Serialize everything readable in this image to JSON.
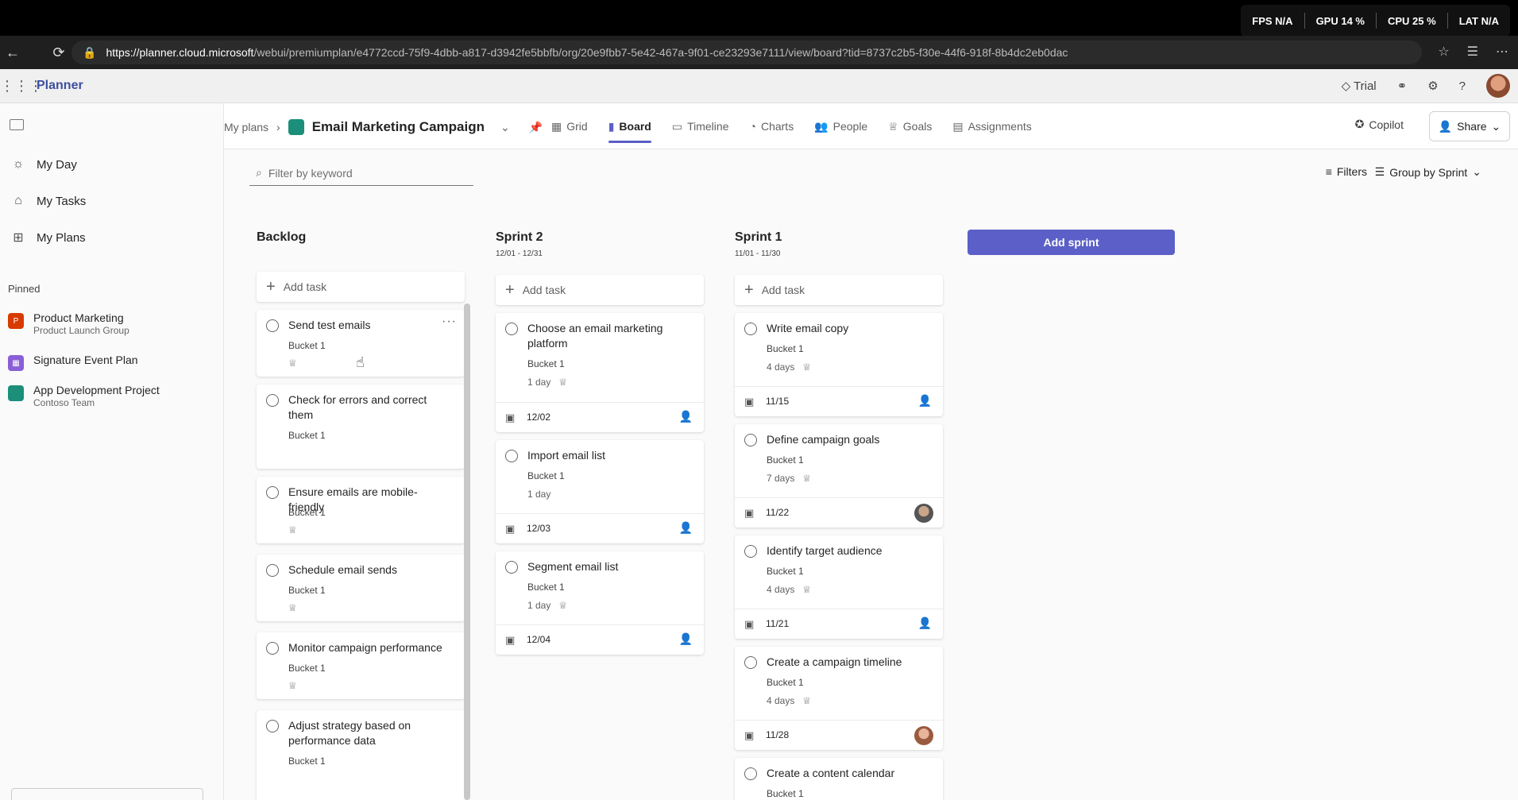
{
  "browser": {
    "url_host": "https://planner.cloud.microsoft",
    "url_path": "/webui/premiumplan/e4772ccd-75f9-4dbb-a817-d3942fe5bbfb/org/20e9fbb7-5e42-467a-9f01-ce23293e7111/view/board?tid=8737c2b5-f30e-44f6-918f-8b4dc2eb0dac",
    "perf": {
      "fps": "N/A",
      "gpu": "GPU 14 %",
      "cpu": "CPU 25 %",
      "lat": "LAT N/A"
    }
  },
  "app": {
    "name": "Planner",
    "trial_label": "Trial"
  },
  "sidebar": {
    "items": [
      {
        "label": "My Day",
        "icon": "sun-icon"
      },
      {
        "label": "My Tasks",
        "icon": "tasks-icon"
      },
      {
        "label": "My Plans",
        "icon": "grid-icon"
      }
    ],
    "pinned_label": "Pinned",
    "pinned": [
      {
        "title": "Product Marketing",
        "subtitle": "Product Launch Group",
        "color": "#d83b01"
      },
      {
        "title": "Signature Event Plan",
        "subtitle": "",
        "color": "#8a5fd6"
      },
      {
        "title": "App Development Project",
        "subtitle": "Contoso Team",
        "color": "#1b8f7a"
      }
    ]
  },
  "header": {
    "breadcrumb_root": "My plans",
    "plan_name": "Email Marketing Campaign",
    "tabs": [
      "Grid",
      "Board",
      "Timeline",
      "Charts",
      "People",
      "Goals",
      "Assignments"
    ],
    "active_tab": "Board",
    "copilot_label": "Copilot",
    "share_label": "Share"
  },
  "toolbar": {
    "filter_placeholder": "Filter by keyword",
    "filters_label": "Filters",
    "group_label": "Group by Sprint"
  },
  "board": {
    "add_task_label": "Add task",
    "add_sprint_label": "Add sprint",
    "columns": [
      {
        "title": "Backlog",
        "dates": "",
        "tasks": [
          {
            "title": "Send test emails",
            "bucket": "Bucket 1"
          },
          {
            "title": "Check for errors and correct them",
            "bucket": "Bucket 1"
          },
          {
            "title": "Ensure emails are mobile-friendly",
            "bucket": "Bucket 1"
          },
          {
            "title": "Schedule email sends",
            "bucket": "Bucket 1"
          },
          {
            "title": "Monitor campaign performance",
            "bucket": "Bucket 1"
          },
          {
            "title": "Adjust strategy based on performance data",
            "bucket": "Bucket 1"
          }
        ]
      },
      {
        "title": "Sprint 2",
        "dates": "12/01 - 12/31",
        "tasks": [
          {
            "title": "Choose an email marketing platform",
            "bucket": "Bucket 1",
            "duration": "1 day",
            "due": "12/02"
          },
          {
            "title": "Import email list",
            "bucket": "Bucket 1",
            "duration": "1 day",
            "due": "12/03"
          },
          {
            "title": "Segment email list",
            "bucket": "Bucket 1",
            "duration": "1 day",
            "due": "12/04"
          }
        ]
      },
      {
        "title": "Sprint 1",
        "dates": "11/01 - 11/30",
        "tasks": [
          {
            "title": "Write email copy",
            "bucket": "Bucket 1",
            "duration": "4 days",
            "due": "11/15"
          },
          {
            "title": "Define campaign goals",
            "bucket": "Bucket 1",
            "duration": "7 days",
            "due": "11/22"
          },
          {
            "title": "Identify target audience",
            "bucket": "Bucket 1",
            "duration": "4 days",
            "due": "11/21"
          },
          {
            "title": "Create a campaign timeline",
            "bucket": "Bucket 1",
            "duration": "4 days",
            "due": "11/28"
          },
          {
            "title": "Create a content calendar",
            "bucket": "Bucket 1"
          }
        ]
      }
    ]
  }
}
